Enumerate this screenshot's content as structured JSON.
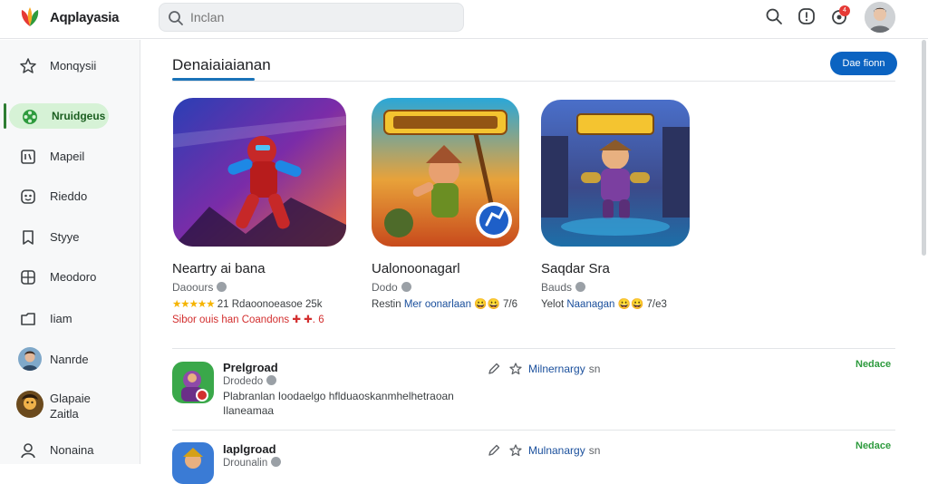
{
  "app": {
    "name": "Aqplayasia"
  },
  "search": {
    "placeholder": "Inclan"
  },
  "header": {
    "notifications_badge": "4"
  },
  "sidebar": {
    "items": [
      {
        "label": "Monqysii",
        "icon": "star-outline-icon"
      },
      {
        "label": "Nruidgeus",
        "icon": "games-icon",
        "active": true
      },
      {
        "label": "Mapeil",
        "icon": "books-icon"
      },
      {
        "label": "Rieddo",
        "icon": "face-icon"
      },
      {
        "label": "Styye",
        "icon": "bookmark-icon"
      },
      {
        "label": "Meodoro",
        "icon": "apps-grid-icon"
      },
      {
        "label": "Iiam",
        "icon": "folder-icon"
      },
      {
        "label": "Nanrde",
        "icon": "user-avatar"
      },
      {
        "label": "Glapaie\nZaitla",
        "icon": "user-avatar"
      },
      {
        "label": "Nonaina",
        "icon": "person-outline-icon"
      }
    ]
  },
  "main": {
    "section_title": "Denaiaiaianan",
    "see_more_label": "Dae fionn",
    "cards": [
      {
        "name": "Neartry ai bana",
        "developer": "Daoours",
        "rating_stars": "★★★★★",
        "meta": "21 Rdaoonoeasoe  25k",
        "promo": "Sibor ouis han Coandons ✚ ✚. 6"
      },
      {
        "name": "Ualonoonagarl",
        "developer": "Dodo",
        "meta_prefix": "Restin",
        "meta_link": "Mer oonarlaan",
        "meta_suffix": "😀😀 7/6"
      },
      {
        "name": "Saqdar Sra",
        "developer": "Bauds",
        "meta_prefix": "Yelot",
        "meta_link": "Naanagan",
        "meta_suffix": "😀😀 7/e3"
      }
    ],
    "list": [
      {
        "name": "Prelgroad",
        "developer": "Drodedo",
        "description": "Plabranlan Ioodaelgo hflduaoskanmhelhetraoan\nIlaneamaa",
        "link": "Milnernargy",
        "link_suffix": "sn",
        "status": "Nedace"
      },
      {
        "name": "Iaplgroad",
        "developer": "Drounalin",
        "description": "",
        "link": "Mulnanargy",
        "link_suffix": "sn",
        "status": "Nedace"
      }
    ]
  },
  "colors": {
    "accent": "#0b63c1",
    "active_nav": "#d6f2d6",
    "promo": "#d32f2f",
    "status": "#2e9b3e"
  }
}
